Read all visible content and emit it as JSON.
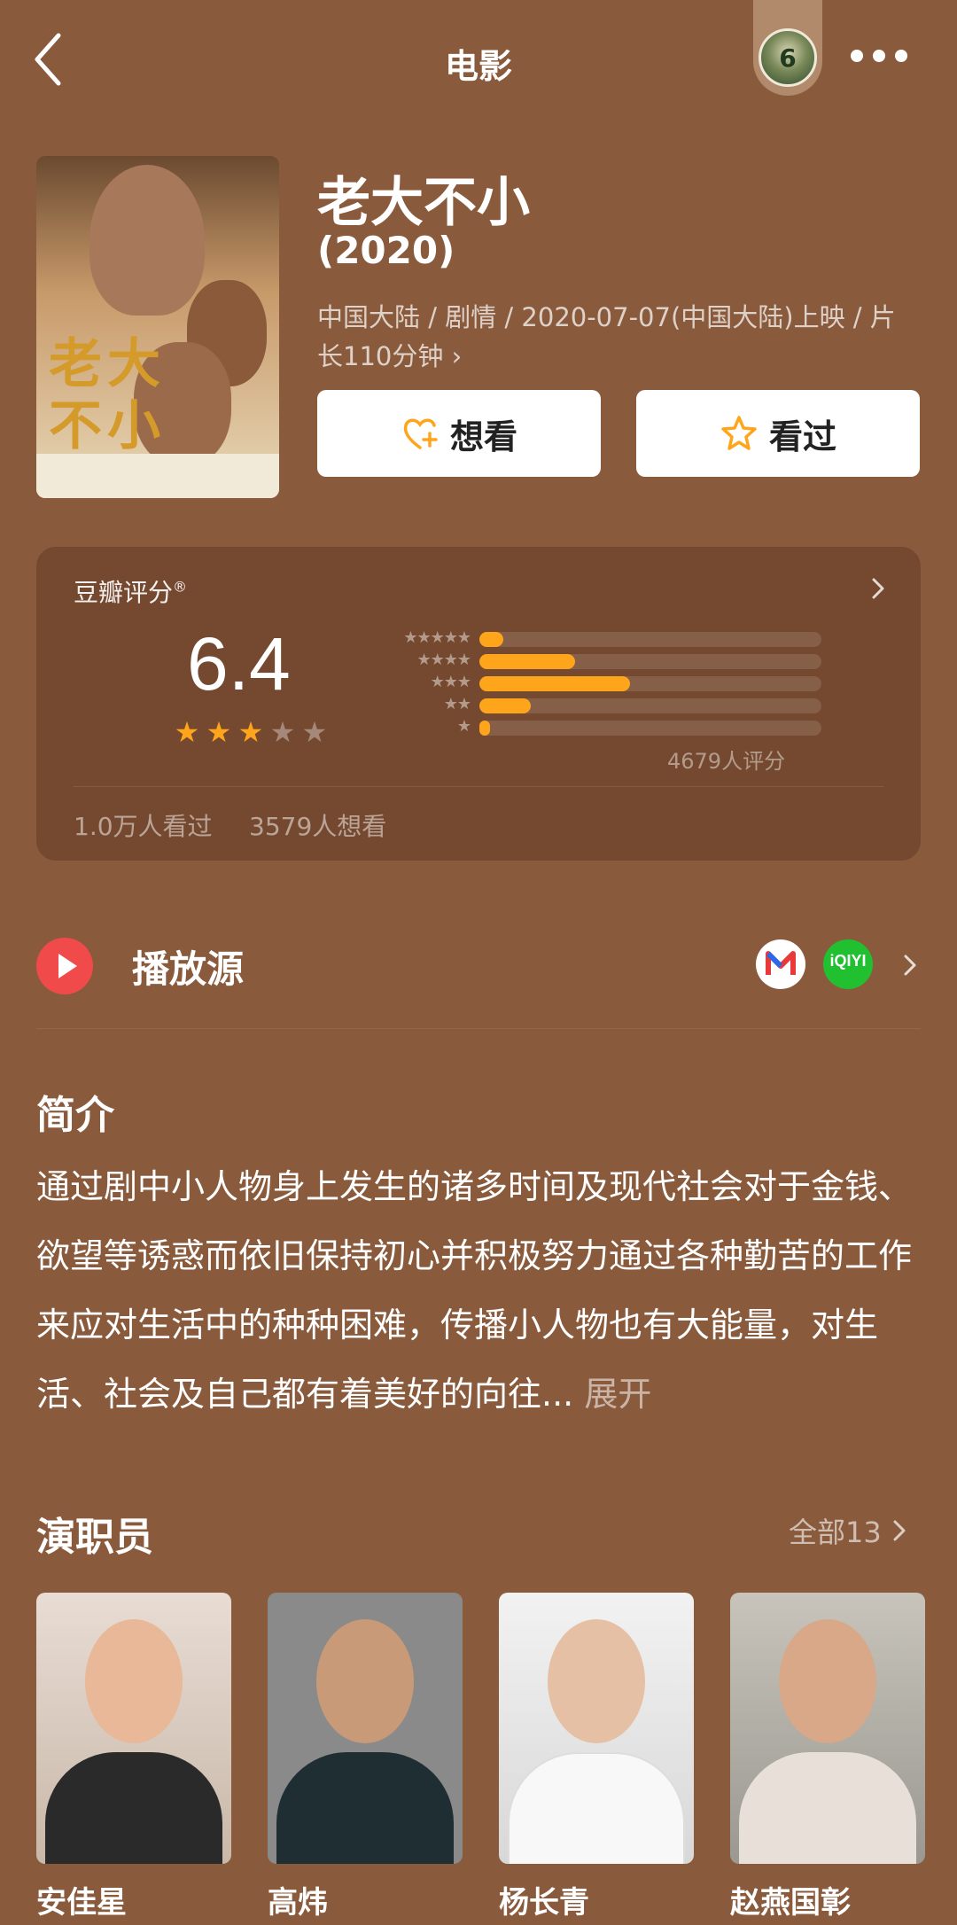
{
  "header": {
    "title": "电影",
    "badge_text": "6"
  },
  "movie": {
    "title": "老大不小",
    "year": "(2020)",
    "meta": "中国大陆 / 剧情 / 2020-07-07(中国大陆)上映 / 片长110分钟 ›",
    "poster_title": "老大不小",
    "want_label": "想看",
    "seen_label": "看过"
  },
  "rating": {
    "label": "豆瓣评分",
    "score": "6.4",
    "stars_filled": 3,
    "stars_total": 5,
    "distribution": [
      {
        "stars": "★★★★★",
        "fraction": 0.07
      },
      {
        "stars": "★★★★",
        "fraction": 0.28
      },
      {
        "stars": "★★★",
        "fraction": 0.44
      },
      {
        "stars": "★★",
        "fraction": 0.15
      },
      {
        "stars": "★",
        "fraction": 0.03
      }
    ],
    "count_text": "4679人评分",
    "seen_text": "1.0万人看过",
    "want_text": "3579人想看"
  },
  "play": {
    "label": "播放源",
    "sources": [
      "mgtv-icon",
      "iqiyi-icon"
    ],
    "iqiyi_text": "iQIYI"
  },
  "intro": {
    "heading": "简介",
    "text": "通过剧中小人物身上发生的诸多时间及现代社会对于金钱、欲望等诱惑而依旧保持初心并积极努力通过各种勤苦的工作来应对生活中的种种困难，传播小人物也有大能量，对生活、社会及自己都有着美好的向往...",
    "expand": "展开"
  },
  "cast": {
    "heading": "演职员",
    "all_label": "全部13",
    "members": [
      {
        "name": "安佳星"
      },
      {
        "name": "高炜"
      },
      {
        "name": "杨长青"
      },
      {
        "name": "赵燕国彰"
      }
    ]
  },
  "colors": {
    "background": "#8a5a3c",
    "card": "#75492f",
    "accent": "#ffa51c",
    "play_red": "#f04a4a",
    "iqiyi_green": "#21c031"
  }
}
